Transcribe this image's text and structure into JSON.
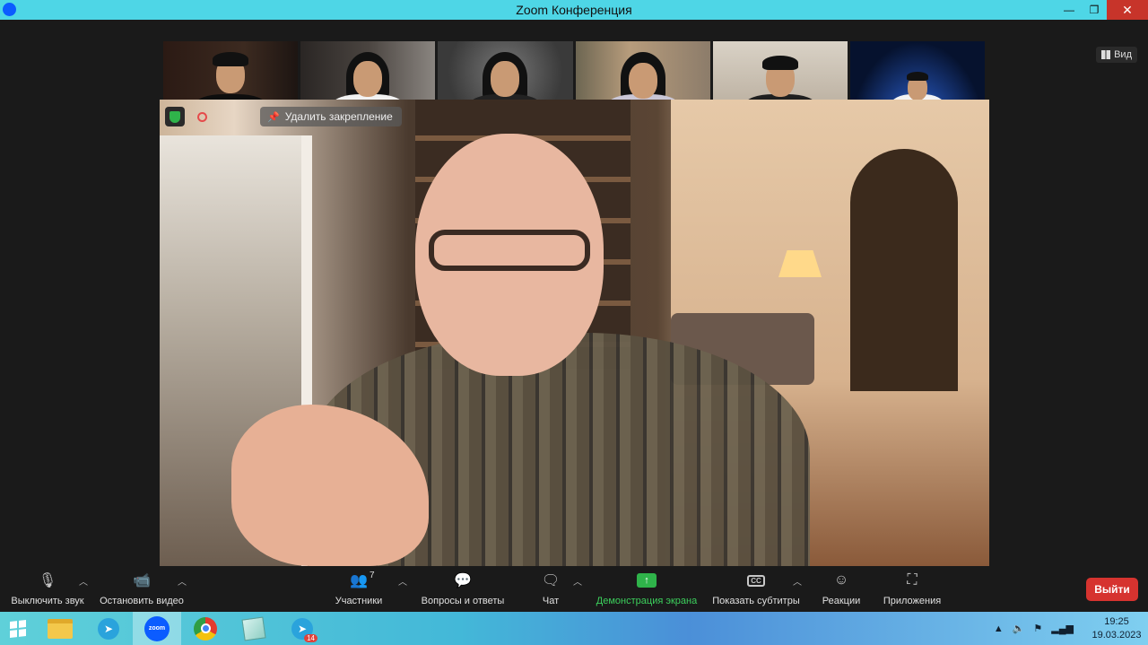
{
  "window": {
    "title": "Zoom Конференция",
    "minimize": "—",
    "restore": "❐",
    "close": "✕"
  },
  "view_button": {
    "label": "Вид"
  },
  "speaker": {
    "unpin_label": "Удалить закрепление"
  },
  "toolbar": {
    "mute": "Выключить звук",
    "stop_video": "Остановить видео",
    "participants": "Участники",
    "participants_count": "7",
    "qa": "Вопросы и ответы",
    "chat": "Чат",
    "share_screen": "Демонстрация экрана",
    "captions": "Показать субтитры",
    "captions_icon": "CC",
    "reactions": "Реакции",
    "apps": "Приложения",
    "leave": "Выйти"
  },
  "taskbar": {
    "zoom_app_label": "zoom",
    "telegram_badge": "14",
    "time": "19:25",
    "date": "19.03.2023"
  },
  "colors": {
    "titlebar": "#4ed6e6",
    "leave": "#d6332f",
    "share": "#2fb34a"
  }
}
